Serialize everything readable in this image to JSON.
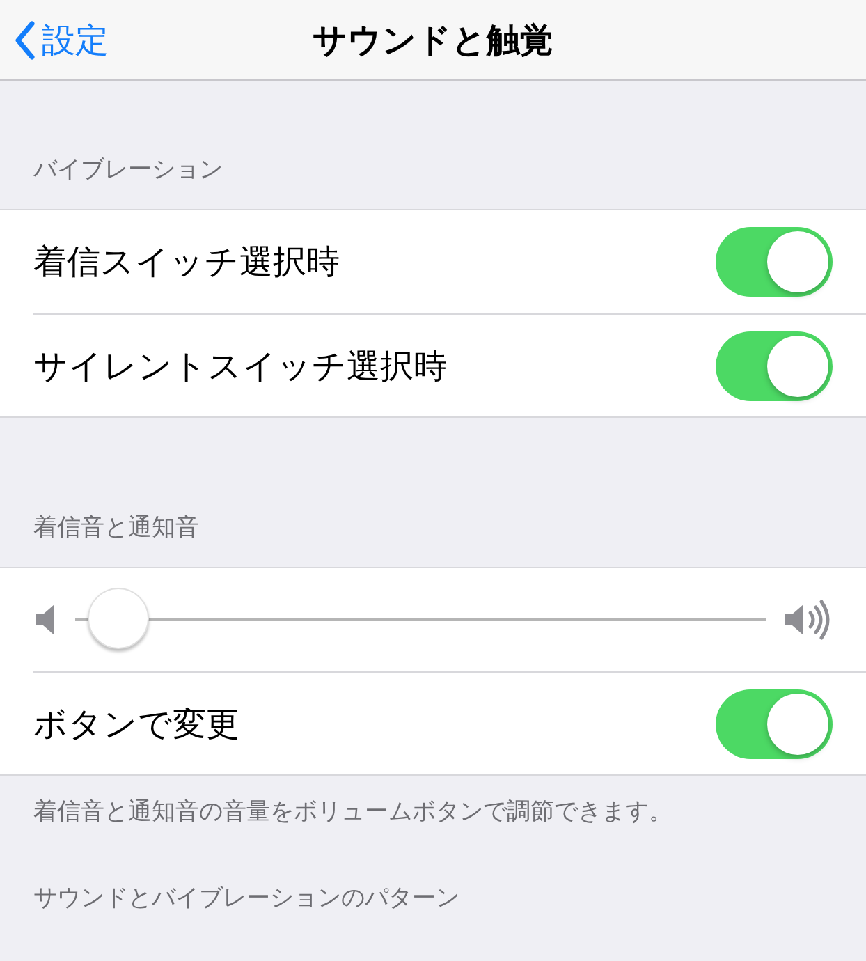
{
  "nav": {
    "back": "設定",
    "title": "サウンドと触覚"
  },
  "sections": [
    {
      "header": "バイブレーション",
      "rows": [
        {
          "kind": "toggle",
          "label": "着信スイッチ選択時",
          "on": true
        },
        {
          "kind": "toggle",
          "label": "サイレントスイッチ選択時",
          "on": true
        }
      ]
    },
    {
      "header": "着信音と通知音",
      "rows": [
        {
          "kind": "slider",
          "level": 0.02
        },
        {
          "kind": "toggle",
          "label": "ボタンで変更",
          "on": true
        }
      ],
      "footer": "着信音と通知音の音量をボリュームボタンで調節できます。"
    },
    {
      "header": "サウンドとバイブレーションのパターン"
    }
  ]
}
